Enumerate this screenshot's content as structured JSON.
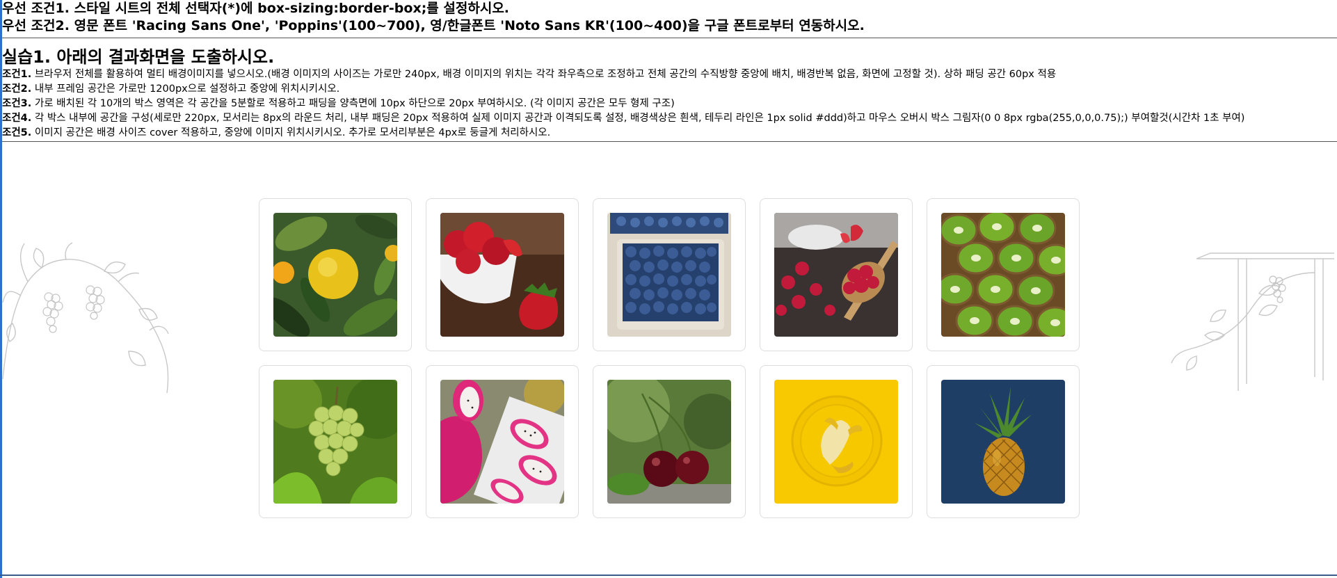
{
  "pre_conditions": [
    "우선 조건1. 스타일 시트의 전체 선택자(*)에 box-sizing:border-box;를 설정하시오.",
    "우선 조건2. 영문 폰트 'Racing Sans One', 'Poppins'(100~700), 영/한글폰트 'Noto Sans KR'(100~400)을 구글 폰트로부터 연동하시오."
  ],
  "exercise_title": "실습1. 아래의 결과화면을 도출하시오.",
  "conditions": [
    {
      "label": "조건1.",
      "text": " 브라우저 전체를 활용하여 멀티 배경이미지를 넣으시오.(배경 이미지의 사이즈는 가로만 240px, 배경 이미지의 위치는 각각 좌우측으로 조정하고 전체 공간의 수직방향 중앙에 배치, 배경반복 없음, 화면에 고정할 것). 상하 패딩 공간 60px 적용"
    },
    {
      "label": "조건2.",
      "text": " 내부 프레임 공간은 가로만 1200px으로 설정하고 중앙에 위치시키시오."
    },
    {
      "label": "조건3.",
      "text": " 가로 배치된 각 10개의 박스 영역은 각 공간을 5분할로 적용하고 패딩을 양측면에 10px 하단으로 20px 부여하시오. (각 이미지 공간은 모두 형제 구조)"
    },
    {
      "label": "조건4.",
      "text": " 각 박스 내부에 공간을 구성(세로만 220px, 모서리는 8px의 라운드 처리, 내부 패딩은 20px 적용하여 실제 이미지 공간과 이격되도록 설정, 배경색상은 흰색, 테두리 라인은 1px solid #ddd)하고 마우스 오버시 박스 그림자(0 0 8px rgba(255,0,0,0.75);) 부여할것(시간차 1초 부여)"
    },
    {
      "label": "조건5.",
      "text": " 이미지 공간은 배경 사이즈 cover 적용하고, 중앙에 이미지 위치시키시오. 추가로 모서리부분은 4px로 둥글게 처리하시오."
    }
  ],
  "fruits": [
    "lemon",
    "strawberry",
    "blueberry",
    "raspberry",
    "kiwi",
    "grape",
    "dragonfruit",
    "cherry",
    "banana",
    "pineapple"
  ]
}
